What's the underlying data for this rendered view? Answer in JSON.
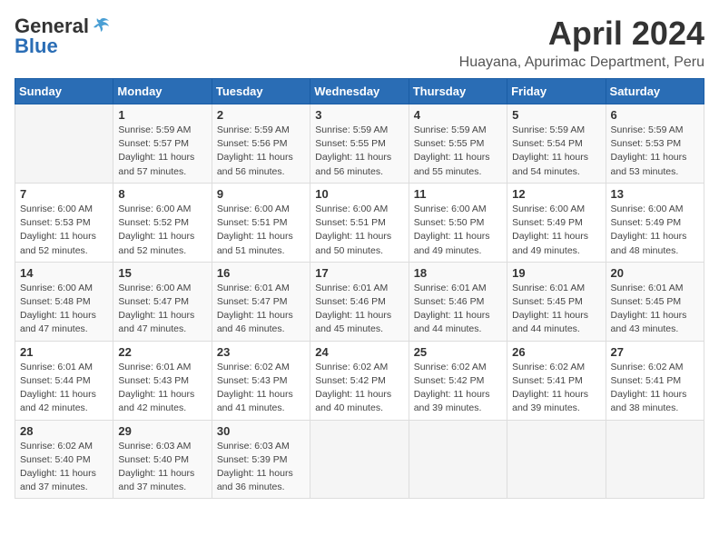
{
  "header": {
    "logo_general": "General",
    "logo_blue": "Blue",
    "month": "April 2024",
    "location": "Huayana, Apurimac Department, Peru"
  },
  "weekdays": [
    "Sunday",
    "Monday",
    "Tuesday",
    "Wednesday",
    "Thursday",
    "Friday",
    "Saturday"
  ],
  "weeks": [
    [
      {
        "day": "",
        "info": ""
      },
      {
        "day": "1",
        "info": "Sunrise: 5:59 AM\nSunset: 5:57 PM\nDaylight: 11 hours\nand 57 minutes."
      },
      {
        "day": "2",
        "info": "Sunrise: 5:59 AM\nSunset: 5:56 PM\nDaylight: 11 hours\nand 56 minutes."
      },
      {
        "day": "3",
        "info": "Sunrise: 5:59 AM\nSunset: 5:55 PM\nDaylight: 11 hours\nand 56 minutes."
      },
      {
        "day": "4",
        "info": "Sunrise: 5:59 AM\nSunset: 5:55 PM\nDaylight: 11 hours\nand 55 minutes."
      },
      {
        "day": "5",
        "info": "Sunrise: 5:59 AM\nSunset: 5:54 PM\nDaylight: 11 hours\nand 54 minutes."
      },
      {
        "day": "6",
        "info": "Sunrise: 5:59 AM\nSunset: 5:53 PM\nDaylight: 11 hours\nand 53 minutes."
      }
    ],
    [
      {
        "day": "7",
        "info": "Sunrise: 6:00 AM\nSunset: 5:53 PM\nDaylight: 11 hours\nand 52 minutes."
      },
      {
        "day": "8",
        "info": "Sunrise: 6:00 AM\nSunset: 5:52 PM\nDaylight: 11 hours\nand 52 minutes."
      },
      {
        "day": "9",
        "info": "Sunrise: 6:00 AM\nSunset: 5:51 PM\nDaylight: 11 hours\nand 51 minutes."
      },
      {
        "day": "10",
        "info": "Sunrise: 6:00 AM\nSunset: 5:51 PM\nDaylight: 11 hours\nand 50 minutes."
      },
      {
        "day": "11",
        "info": "Sunrise: 6:00 AM\nSunset: 5:50 PM\nDaylight: 11 hours\nand 49 minutes."
      },
      {
        "day": "12",
        "info": "Sunrise: 6:00 AM\nSunset: 5:49 PM\nDaylight: 11 hours\nand 49 minutes."
      },
      {
        "day": "13",
        "info": "Sunrise: 6:00 AM\nSunset: 5:49 PM\nDaylight: 11 hours\nand 48 minutes."
      }
    ],
    [
      {
        "day": "14",
        "info": "Sunrise: 6:00 AM\nSunset: 5:48 PM\nDaylight: 11 hours\nand 47 minutes."
      },
      {
        "day": "15",
        "info": "Sunrise: 6:00 AM\nSunset: 5:47 PM\nDaylight: 11 hours\nand 47 minutes."
      },
      {
        "day": "16",
        "info": "Sunrise: 6:01 AM\nSunset: 5:47 PM\nDaylight: 11 hours\nand 46 minutes."
      },
      {
        "day": "17",
        "info": "Sunrise: 6:01 AM\nSunset: 5:46 PM\nDaylight: 11 hours\nand 45 minutes."
      },
      {
        "day": "18",
        "info": "Sunrise: 6:01 AM\nSunset: 5:46 PM\nDaylight: 11 hours\nand 44 minutes."
      },
      {
        "day": "19",
        "info": "Sunrise: 6:01 AM\nSunset: 5:45 PM\nDaylight: 11 hours\nand 44 minutes."
      },
      {
        "day": "20",
        "info": "Sunrise: 6:01 AM\nSunset: 5:45 PM\nDaylight: 11 hours\nand 43 minutes."
      }
    ],
    [
      {
        "day": "21",
        "info": "Sunrise: 6:01 AM\nSunset: 5:44 PM\nDaylight: 11 hours\nand 42 minutes."
      },
      {
        "day": "22",
        "info": "Sunrise: 6:01 AM\nSunset: 5:43 PM\nDaylight: 11 hours\nand 42 minutes."
      },
      {
        "day": "23",
        "info": "Sunrise: 6:02 AM\nSunset: 5:43 PM\nDaylight: 11 hours\nand 41 minutes."
      },
      {
        "day": "24",
        "info": "Sunrise: 6:02 AM\nSunset: 5:42 PM\nDaylight: 11 hours\nand 40 minutes."
      },
      {
        "day": "25",
        "info": "Sunrise: 6:02 AM\nSunset: 5:42 PM\nDaylight: 11 hours\nand 39 minutes."
      },
      {
        "day": "26",
        "info": "Sunrise: 6:02 AM\nSunset: 5:41 PM\nDaylight: 11 hours\nand 39 minutes."
      },
      {
        "day": "27",
        "info": "Sunrise: 6:02 AM\nSunset: 5:41 PM\nDaylight: 11 hours\nand 38 minutes."
      }
    ],
    [
      {
        "day": "28",
        "info": "Sunrise: 6:02 AM\nSunset: 5:40 PM\nDaylight: 11 hours\nand 37 minutes."
      },
      {
        "day": "29",
        "info": "Sunrise: 6:03 AM\nSunset: 5:40 PM\nDaylight: 11 hours\nand 37 minutes."
      },
      {
        "day": "30",
        "info": "Sunrise: 6:03 AM\nSunset: 5:39 PM\nDaylight: 11 hours\nand 36 minutes."
      },
      {
        "day": "",
        "info": ""
      },
      {
        "day": "",
        "info": ""
      },
      {
        "day": "",
        "info": ""
      },
      {
        "day": "",
        "info": ""
      }
    ]
  ]
}
